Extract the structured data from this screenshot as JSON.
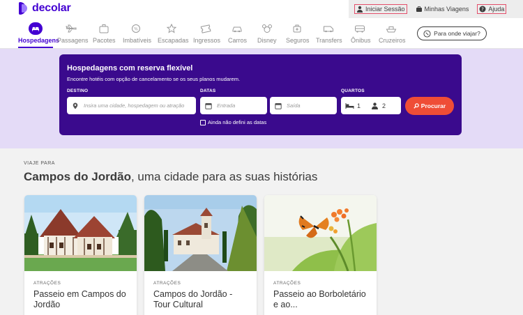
{
  "brand": {
    "name": "decolar",
    "color": "#4300d2"
  },
  "toplinks": [
    {
      "label": "Iniciar Sessão",
      "icon": "user-icon"
    },
    {
      "label": "Minhas Viagens",
      "icon": "suitcase-icon"
    },
    {
      "label": "Ajuda",
      "icon": "help-icon"
    }
  ],
  "nav": {
    "items": [
      {
        "label": "Hospedagens",
        "icon": "bed-icon",
        "active": true
      },
      {
        "label": "Passagens",
        "icon": "plane-icon"
      },
      {
        "label": "Pacotes",
        "icon": "suitcase-icon"
      },
      {
        "label": "Imbatíveis",
        "icon": "badge-icon"
      },
      {
        "label": "Escapadas",
        "icon": "star-icon"
      },
      {
        "label": "Ingressos",
        "icon": "ticket-icon"
      },
      {
        "label": "Carros",
        "icon": "car-icon"
      },
      {
        "label": "Disney",
        "icon": "mickey-icon"
      },
      {
        "label": "Seguros",
        "icon": "insurance-icon"
      },
      {
        "label": "Transfers",
        "icon": "van-icon"
      },
      {
        "label": "Ônibus",
        "icon": "bus-icon"
      },
      {
        "label": "Cruzeiros",
        "icon": "ship-icon"
      }
    ],
    "explore_label": "Para onde viajar?"
  },
  "search": {
    "title": "Hospedagens com reserva flexível",
    "subtitle": "Encontre hotéis com opção de cancelamento se os seus planos mudarem.",
    "labels": {
      "destination": "DESTINO",
      "dates": "DATAS",
      "rooms": "QUARTOS"
    },
    "destination_placeholder": "Insira uma cidade, hospedagem ou atração",
    "checkin_placeholder": "Entrada",
    "checkout_placeholder": "Saída",
    "rooms_count": "1",
    "guests_count": "2",
    "button_label": "Procurar",
    "no_dates_label": "Ainda não defini as datas",
    "accent": "#ef4d36",
    "panel_color": "#3a0a8d"
  },
  "section": {
    "eyebrow": "VIAJE PARA",
    "title_bold": "Campos do Jordão",
    "title_rest": ", uma cidade para as suas histórias",
    "cards": [
      {
        "category": "ATRAÇÕES",
        "title": "Passeio em Campos do Jordão"
      },
      {
        "category": "ATRAÇÕES",
        "title": "Campos do Jordão - Tour Cultural"
      },
      {
        "category": "ATRAÇÕES",
        "title": "Passeio ao Borboletário e ao..."
      }
    ]
  }
}
